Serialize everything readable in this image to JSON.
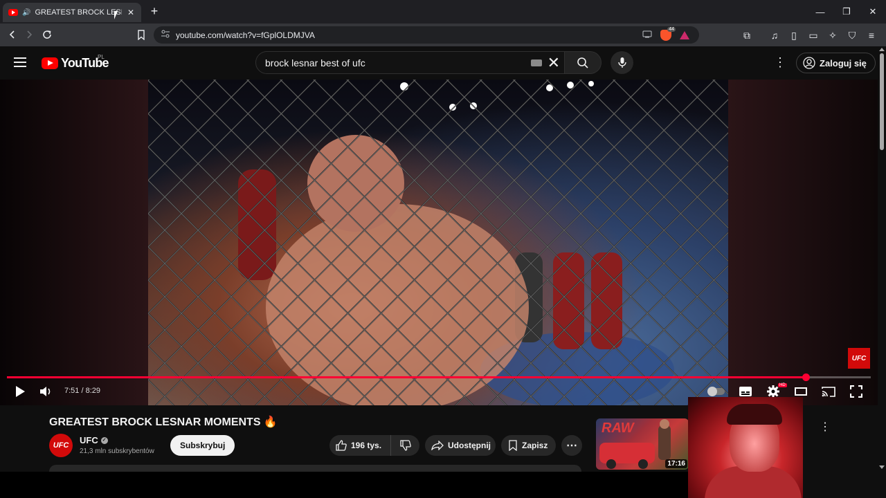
{
  "browser": {
    "tab_title": "GREATEST BROCK LESNAR M",
    "url": "youtube.com/watch?v=fGplOLDMJVA",
    "shields_count": "44"
  },
  "youtube": {
    "logo_text": "YouTube",
    "region": "PL",
    "search_value": "brock lesnar best of ufc",
    "signin_label": "Zaloguj się"
  },
  "player": {
    "current_time": "7:51",
    "duration": "8:29",
    "timecode": "7:51 / 8:29",
    "progress_fraction": 0.925,
    "brand_bug": "UFC",
    "hd_label": "HD"
  },
  "video": {
    "title": "GREATEST BROCK LESNAR MOMENTS",
    "channel_name": "UFC",
    "subscribers": "21,3 mln subskrybentów",
    "subscribe_label": "Subskrybuj",
    "likes": "196 tys.",
    "share_label": "Udostępnij",
    "save_label": "Zapisz"
  },
  "recommended": {
    "duration": "17:16"
  },
  "colors": {
    "accent": "#ff0033",
    "brand_red": "#ff0000",
    "ufc_red": "#d20a0a"
  }
}
